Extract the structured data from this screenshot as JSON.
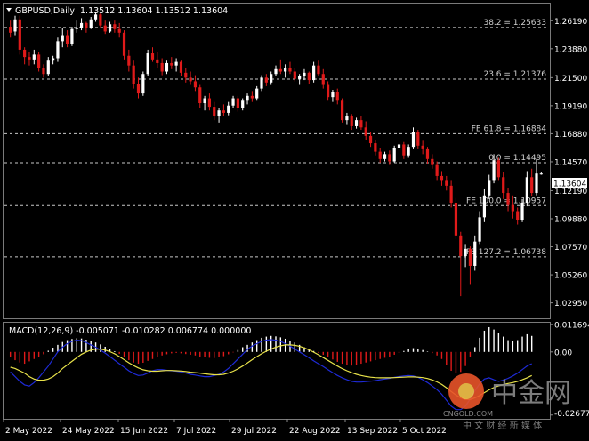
{
  "header": {
    "symbol": "GBPUSD,Daily",
    "ohlc": "1.13512 1.13604 1.13512 1.13604"
  },
  "macd_header": "MACD(12,26,9) -0.005071 -0.010282 0.006774 0.000000",
  "current_price_label": "1.13604",
  "watermark": {
    "brand": "中金网",
    "sub": "中 文 财 经 新 媒 体",
    "url": "CNGOLD.COM"
  },
  "colors": {
    "background": "#000000",
    "bull_candle": "#ffffff",
    "bear_candle": "#e01a1a",
    "level_line": "#c8c8c8",
    "macd_line": "#1e2ad6",
    "signal_line": "#e8e24a",
    "hist_pos": "#ffffff",
    "hist_neg": "#e01a1a"
  },
  "chart_data": [
    {
      "type": "candlestick",
      "panel": "price",
      "ylim": [
        1.0175,
        1.2753
      ],
      "y_ticks": [
        "1.26190",
        "1.23880",
        "1.21500",
        "1.19190",
        "1.16880",
        "1.14570",
        "1.12190",
        "1.09880",
        "1.07570",
        "1.05260",
        "1.02950"
      ],
      "x_ticks": [
        "2 May 2022",
        "24 May 2022",
        "15 Jun 2022",
        "7 Jul 2022",
        "29 Jul 2022",
        "22 Aug 2022",
        "13 Sep 2022",
        "5 Oct 2022"
      ],
      "levels": [
        {
          "label": "38.2 = 1.25633",
          "value": 1.25633
        },
        {
          "label": "23.6 = 1.21376",
          "value": 1.21376
        },
        {
          "label": "FE 61.8 = 1.16884",
          "value": 1.16884
        },
        {
          "label": "0.0 = 1.14495",
          "value": 1.14495
        },
        {
          "label": "FE 100.0 = 1.10957",
          "value": 1.10957
        },
        {
          "label": "FE 127.2 = 1.06738",
          "value": 1.06738
        }
      ],
      "candles": [
        [
          1.257,
          1.262,
          1.248,
          1.252
        ],
        [
          1.253,
          1.266,
          1.25,
          1.263
        ],
        [
          1.263,
          1.266,
          1.234,
          1.238
        ],
        [
          1.238,
          1.24,
          1.226,
          1.232
        ],
        [
          1.232,
          1.236,
          1.225,
          1.23
        ],
        [
          1.23,
          1.238,
          1.226,
          1.234
        ],
        [
          1.234,
          1.236,
          1.22,
          1.223
        ],
        [
          1.223,
          1.226,
          1.215,
          1.218
        ],
        [
          1.218,
          1.232,
          1.216,
          1.229
        ],
        [
          1.229,
          1.233,
          1.226,
          1.231
        ],
        [
          1.231,
          1.248,
          1.228,
          1.245
        ],
        [
          1.245,
          1.256,
          1.24,
          1.25
        ],
        [
          1.25,
          1.254,
          1.24,
          1.243
        ],
        [
          1.243,
          1.257,
          1.241,
          1.255
        ],
        [
          1.255,
          1.262,
          1.252,
          1.256
        ],
        [
          1.256,
          1.264,
          1.254,
          1.26
        ],
        [
          1.26,
          1.261,
          1.252,
          1.256
        ],
        [
          1.256,
          1.265,
          1.255,
          1.263
        ],
        [
          1.263,
          1.269,
          1.261,
          1.267
        ],
        [
          1.267,
          1.268,
          1.256,
          1.258
        ],
        [
          1.258,
          1.262,
          1.251,
          1.253
        ],
        [
          1.253,
          1.261,
          1.252,
          1.259
        ],
        [
          1.259,
          1.262,
          1.252,
          1.255
        ],
        [
          1.255,
          1.26,
          1.248,
          1.252
        ],
        [
          1.252,
          1.254,
          1.23,
          1.233
        ],
        [
          1.233,
          1.238,
          1.22,
          1.225
        ],
        [
          1.225,
          1.229,
          1.206,
          1.21
        ],
        [
          1.21,
          1.215,
          1.198,
          1.202
        ],
        [
          1.202,
          1.22,
          1.2,
          1.218
        ],
        [
          1.218,
          1.238,
          1.216,
          1.235
        ],
        [
          1.235,
          1.24,
          1.228,
          1.23
        ],
        [
          1.23,
          1.236,
          1.223,
          1.227
        ],
        [
          1.227,
          1.231,
          1.217,
          1.22
        ],
        [
          1.22,
          1.229,
          1.218,
          1.227
        ],
        [
          1.227,
          1.232,
          1.222,
          1.225
        ],
        [
          1.225,
          1.231,
          1.22,
          1.228
        ],
        [
          1.228,
          1.229,
          1.216,
          1.219
        ],
        [
          1.219,
          1.223,
          1.211,
          1.215
        ],
        [
          1.215,
          1.22,
          1.209,
          1.212
        ],
        [
          1.212,
          1.217,
          1.204,
          1.207
        ],
        [
          1.207,
          1.209,
          1.19,
          1.194
        ],
        [
          1.194,
          1.2,
          1.188,
          1.198
        ],
        [
          1.198,
          1.202,
          1.188,
          1.191
        ],
        [
          1.191,
          1.195,
          1.18,
          1.183
        ],
        [
          1.183,
          1.19,
          1.178,
          1.188
        ],
        [
          1.188,
          1.193,
          1.183,
          1.186
        ],
        [
          1.186,
          1.195,
          1.184,
          1.192
        ],
        [
          1.192,
          1.2,
          1.19,
          1.198
        ],
        [
          1.198,
          1.2,
          1.187,
          1.19
        ],
        [
          1.19,
          1.198,
          1.188,
          1.196
        ],
        [
          1.196,
          1.202,
          1.193,
          1.2
        ],
        [
          1.2,
          1.204,
          1.195,
          1.198
        ],
        [
          1.198,
          1.208,
          1.196,
          1.206
        ],
        [
          1.206,
          1.217,
          1.204,
          1.215
        ],
        [
          1.215,
          1.218,
          1.208,
          1.211
        ],
        [
          1.211,
          1.22,
          1.209,
          1.218
        ],
        [
          1.218,
          1.225,
          1.216,
          1.222
        ],
        [
          1.222,
          1.23,
          1.218,
          1.22
        ],
        [
          1.22,
          1.226,
          1.215,
          1.223
        ],
        [
          1.223,
          1.228,
          1.218,
          1.22
        ],
        [
          1.22,
          1.223,
          1.212,
          1.214
        ],
        [
          1.214,
          1.218,
          1.209,
          1.216
        ],
        [
          1.216,
          1.222,
          1.213,
          1.219
        ],
        [
          1.219,
          1.22,
          1.21,
          1.213
        ],
        [
          1.213,
          1.228,
          1.211,
          1.225
        ],
        [
          1.225,
          1.229,
          1.216,
          1.218
        ],
        [
          1.218,
          1.222,
          1.206,
          1.209
        ],
        [
          1.209,
          1.212,
          1.196,
          1.199
        ],
        [
          1.199,
          1.205,
          1.195,
          1.203
        ],
        [
          1.203,
          1.206,
          1.193,
          1.196
        ],
        [
          1.196,
          1.198,
          1.178,
          1.18
        ],
        [
          1.18,
          1.186,
          1.176,
          1.183
        ],
        [
          1.183,
          1.185,
          1.172,
          1.175
        ],
        [
          1.175,
          1.182,
          1.173,
          1.18
        ],
        [
          1.18,
          1.183,
          1.172,
          1.174
        ],
        [
          1.174,
          1.179,
          1.164,
          1.167
        ],
        [
          1.167,
          1.17,
          1.158,
          1.161
        ],
        [
          1.161,
          1.164,
          1.151,
          1.154
        ],
        [
          1.154,
          1.157,
          1.145,
          1.148
        ],
        [
          1.148,
          1.154,
          1.146,
          1.152
        ],
        [
          1.152,
          1.155,
          1.143,
          1.146
        ],
        [
          1.146,
          1.159,
          1.145,
          1.157
        ],
        [
          1.157,
          1.163,
          1.154,
          1.16
        ],
        [
          1.16,
          1.162,
          1.148,
          1.151
        ],
        [
          1.151,
          1.16,
          1.149,
          1.158
        ],
        [
          1.158,
          1.174,
          1.156,
          1.17
        ],
        [
          1.17,
          1.172,
          1.156,
          1.159
        ],
        [
          1.159,
          1.163,
          1.152,
          1.156
        ],
        [
          1.156,
          1.158,
          1.144,
          1.148
        ],
        [
          1.148,
          1.152,
          1.14,
          1.143
        ],
        [
          1.143,
          1.146,
          1.13,
          1.134
        ],
        [
          1.134,
          1.138,
          1.126,
          1.13
        ],
        [
          1.13,
          1.134,
          1.122,
          1.126
        ],
        [
          1.126,
          1.13,
          1.108,
          1.112
        ],
        [
          1.112,
          1.116,
          1.082,
          1.085
        ],
        [
          1.085,
          1.088,
          1.035,
          1.068
        ],
        [
          1.068,
          1.078,
          1.059,
          1.074
        ],
        [
          1.074,
          1.076,
          1.045,
          1.06
        ],
        [
          1.06,
          1.085,
          1.056,
          1.08
        ],
        [
          1.08,
          1.105,
          1.078,
          1.1
        ],
        [
          1.1,
          1.123,
          1.096,
          1.118
        ],
        [
          1.118,
          1.135,
          1.115,
          1.13
        ],
        [
          1.13,
          1.152,
          1.128,
          1.147
        ],
        [
          1.147,
          1.149,
          1.13,
          1.133
        ],
        [
          1.133,
          1.137,
          1.115,
          1.12
        ],
        [
          1.12,
          1.124,
          1.105,
          1.11
        ],
        [
          1.11,
          1.118,
          1.099,
          1.105
        ],
        [
          1.105,
          1.108,
          1.094,
          1.098
        ],
        [
          1.098,
          1.115,
          1.096,
          1.112
        ],
        [
          1.112,
          1.138,
          1.109,
          1.133
        ],
        [
          1.133,
          1.14,
          1.117,
          1.12
        ],
        [
          1.12,
          1.148,
          1.118,
          1.136
        ],
        [
          1.136,
          1.137,
          1.135,
          1.136
        ]
      ]
    },
    {
      "type": "bar",
      "panel": "macd",
      "ylim": [
        -0.028,
        0.012
      ],
      "y_ticks": [
        "0.011694",
        "0.00",
        "-0.02677"
      ],
      "histogram": [
        -0.002,
        -0.0035,
        -0.0045,
        -0.005,
        -0.004,
        -0.003,
        -0.002,
        -0.001,
        0.0005,
        0.0018,
        0.003,
        0.0042,
        0.005,
        0.0055,
        0.0058,
        0.0057,
        0.0052,
        0.0046,
        0.004,
        0.0032,
        0.0022,
        0.0012,
        0.0003,
        -0.0008,
        -0.0022,
        -0.0035,
        -0.0045,
        -0.005,
        -0.0046,
        -0.0038,
        -0.003,
        -0.0022,
        -0.0015,
        -0.001,
        -0.0006,
        -0.0004,
        -0.0006,
        -0.0009,
        -0.0012,
        -0.0015,
        -0.002,
        -0.0022,
        -0.0025,
        -0.0026,
        -0.0022,
        -0.0018,
        -0.001,
        -0.0002,
        0.0008,
        0.002,
        0.003,
        0.004,
        0.005,
        0.006,
        0.0065,
        0.0068,
        0.0066,
        0.0062,
        0.0056,
        0.0048,
        0.004,
        0.003,
        0.002,
        0.0012,
        0.0004,
        -0.0004,
        -0.0012,
        -0.0022,
        -0.0032,
        -0.0042,
        -0.005,
        -0.0055,
        -0.0058,
        -0.0056,
        -0.005,
        -0.0045,
        -0.004,
        -0.0035,
        -0.003,
        -0.0025,
        -0.002,
        -0.0012,
        -0.0004,
        0.0004,
        0.0012,
        0.0016,
        0.0014,
        0.0008,
        0.0002,
        -0.0005,
        -0.0015,
        -0.003,
        -0.0055,
        -0.008,
        -0.009,
        -0.0085,
        -0.006,
        -0.002,
        0.002,
        0.006,
        0.009,
        0.0105,
        0.0095,
        0.008,
        0.0065,
        0.005,
        0.0045,
        0.005,
        0.0065,
        0.0075,
        0.0068
      ],
      "series": [
        {
          "values": [
            -0.0085,
            -0.0105,
            -0.0125,
            -0.014,
            -0.0145,
            -0.013,
            -0.011,
            -0.0085,
            -0.006,
            -0.003,
            0.0,
            0.002,
            0.0035,
            0.0045,
            0.005,
            0.0048,
            0.004,
            0.003,
            0.002,
            0.0008,
            -0.0005,
            -0.002,
            -0.0035,
            -0.005,
            -0.0065,
            -0.008,
            -0.0092,
            -0.01,
            -0.0098,
            -0.009,
            -0.008,
            -0.0075,
            -0.0075,
            -0.0078,
            -0.008,
            -0.0082,
            -0.0085,
            -0.009,
            -0.0095,
            -0.0098,
            -0.0102,
            -0.0105,
            -0.0105,
            -0.01,
            -0.0095,
            -0.0085,
            -0.007,
            -0.005,
            -0.003,
            -0.001,
            0.001,
            0.0025,
            0.0035,
            0.0045,
            0.005,
            0.0052,
            0.005,
            0.0045,
            0.0035,
            0.0025,
            0.0012,
            0.0,
            -0.0012,
            -0.0025,
            -0.0038,
            -0.005,
            -0.0062,
            -0.0075,
            -0.0088,
            -0.01,
            -0.011,
            -0.0118,
            -0.0125,
            -0.0128,
            -0.0128,
            -0.0126,
            -0.0124,
            -0.0122,
            -0.0118,
            -0.0115,
            -0.0112,
            -0.0108,
            -0.0105,
            -0.0102,
            -0.01,
            -0.0102,
            -0.0108,
            -0.0118,
            -0.013,
            -0.0145,
            -0.016,
            -0.018,
            -0.0205,
            -0.023,
            -0.0245,
            -0.0245,
            -0.023,
            -0.02,
            -0.0165,
            -0.0135,
            -0.0115,
            -0.011,
            -0.0118,
            -0.0125,
            -0.012,
            -0.0112,
            -0.0102,
            -0.009,
            -0.0075,
            -0.006,
            -0.005
          ]
        },
        {
          "values": [
            -0.0065,
            -0.007,
            -0.008,
            -0.009,
            -0.0105,
            -0.0115,
            -0.012,
            -0.012,
            -0.0115,
            -0.0105,
            -0.009,
            -0.007,
            -0.0055,
            -0.004,
            -0.0025,
            -0.001,
            0.0,
            0.0008,
            0.0012,
            0.0012,
            0.0008,
            0.0001,
            -0.0008,
            -0.002,
            -0.0033,
            -0.0046,
            -0.0058,
            -0.0068,
            -0.0076,
            -0.008,
            -0.0082,
            -0.0082,
            -0.008,
            -0.0079,
            -0.0079,
            -0.008,
            -0.0081,
            -0.0083,
            -0.0086,
            -0.0088,
            -0.009,
            -0.0093,
            -0.0095,
            -0.0097,
            -0.0097,
            -0.0095,
            -0.009,
            -0.0082,
            -0.0072,
            -0.006,
            -0.0047,
            -0.0033,
            -0.002,
            -0.0008,
            0.0003,
            0.0012,
            0.002,
            0.0026,
            0.003,
            0.003,
            0.0028,
            0.0024,
            0.0017,
            0.0009,
            -0.0001,
            -0.0012,
            -0.0024,
            -0.0036,
            -0.0048,
            -0.006,
            -0.0071,
            -0.008,
            -0.0088,
            -0.0095,
            -0.01,
            -0.0104,
            -0.0107,
            -0.0109,
            -0.011,
            -0.011,
            -0.011,
            -0.0109,
            -0.0108,
            -0.0107,
            -0.0106,
            -0.0106,
            -0.0107,
            -0.0109,
            -0.0113,
            -0.0119,
            -0.0127,
            -0.0138,
            -0.0152,
            -0.0168,
            -0.0183,
            -0.0195,
            -0.0202,
            -0.0202,
            -0.0195,
            -0.0185,
            -0.0173,
            -0.0161,
            -0.0151,
            -0.0144,
            -0.0139,
            -0.0134,
            -0.013,
            -0.0125,
            -0.0118,
            -0.011,
            -0.01
          ]
        }
      ]
    }
  ]
}
